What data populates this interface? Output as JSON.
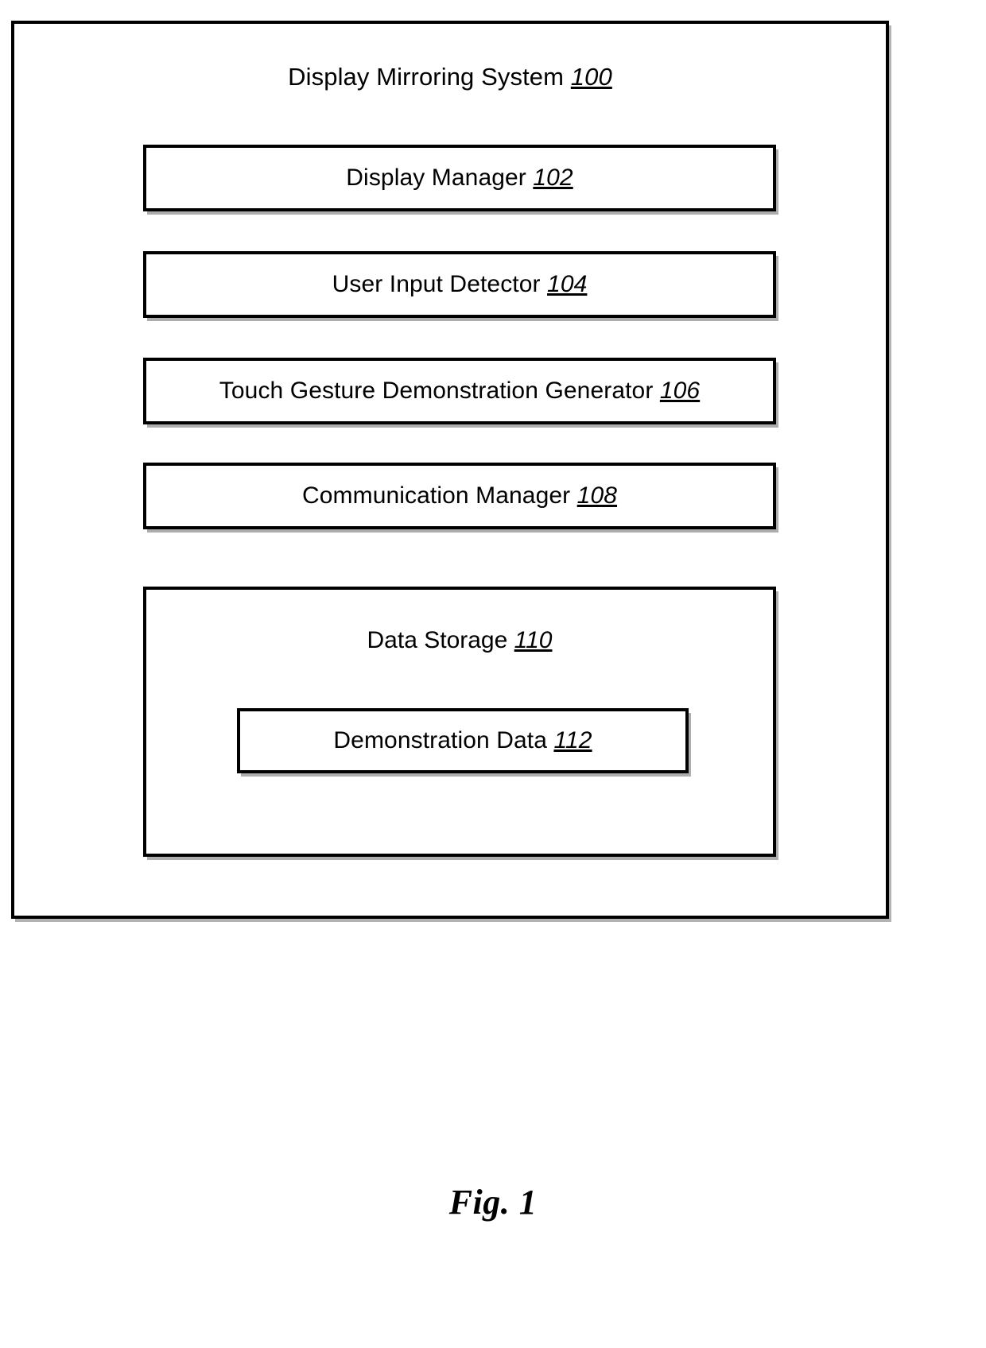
{
  "figure": {
    "caption": "Fig. 1"
  },
  "system": {
    "title_text": "Display Mirroring System",
    "title_ref": "100",
    "components": [
      {
        "label": "Display Manager",
        "ref": "102"
      },
      {
        "label": "User Input Detector",
        "ref": "104"
      },
      {
        "label": "Touch Gesture Demonstration Generator",
        "ref": "106"
      },
      {
        "label": "Communication Manager",
        "ref": "108"
      }
    ],
    "data_storage": {
      "label": "Data Storage",
      "ref": "110",
      "children": [
        {
          "label": "Demonstration Data",
          "ref": "112"
        }
      ]
    }
  },
  "colors": {
    "stroke": "#000000",
    "background": "#ffffff",
    "text": "#000000"
  }
}
